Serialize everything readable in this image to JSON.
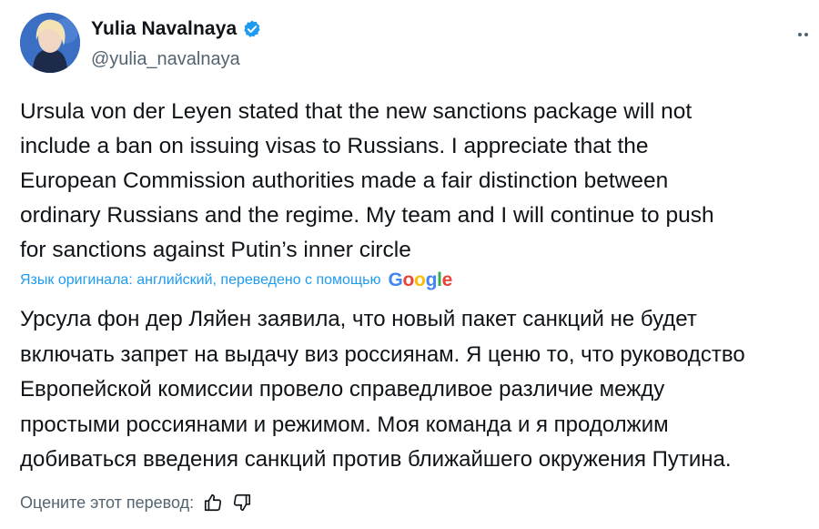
{
  "author": {
    "display_name": "Yulia Navalnaya",
    "handle": "@yulia_navalnaya",
    "verified_badge_color": "#1d9bf0"
  },
  "tweet": {
    "text": "Ursula von der Leyen stated that the new sanctions package will not\ninclude a ban on issuing visas to Russians. I appreciate that the\nEuropean Commission authorities made a fair distinction between\nordinary Russians and the regime. My team and I will continue to push\nfor sanctions against Putin’s inner circle"
  },
  "translation": {
    "note": "Язык оригинала: английский, переведено с помощью",
    "provider_logo": "Google",
    "text": "Урсула фон дер Ляйен заявила, что новый пакет санкций не будет\nвключать запрет на выдачу виз россиянам. Я ценю то, что руководство\nЕвропейской комиссии провело справедливое различие между\nпростыми россиянами и режимом. Моя команда и я продолжим\nдобиваться введения санкций против ближайшего окружения Путина."
  },
  "rating": {
    "label": "Оцените этот перевод:",
    "thumbs_up_icon": "thumbs-up-icon",
    "thumbs_down_icon": "thumbs-down-icon"
  },
  "colors": {
    "link_blue": "#1d9bf0",
    "text": "#0f1419",
    "muted": "#536471"
  }
}
